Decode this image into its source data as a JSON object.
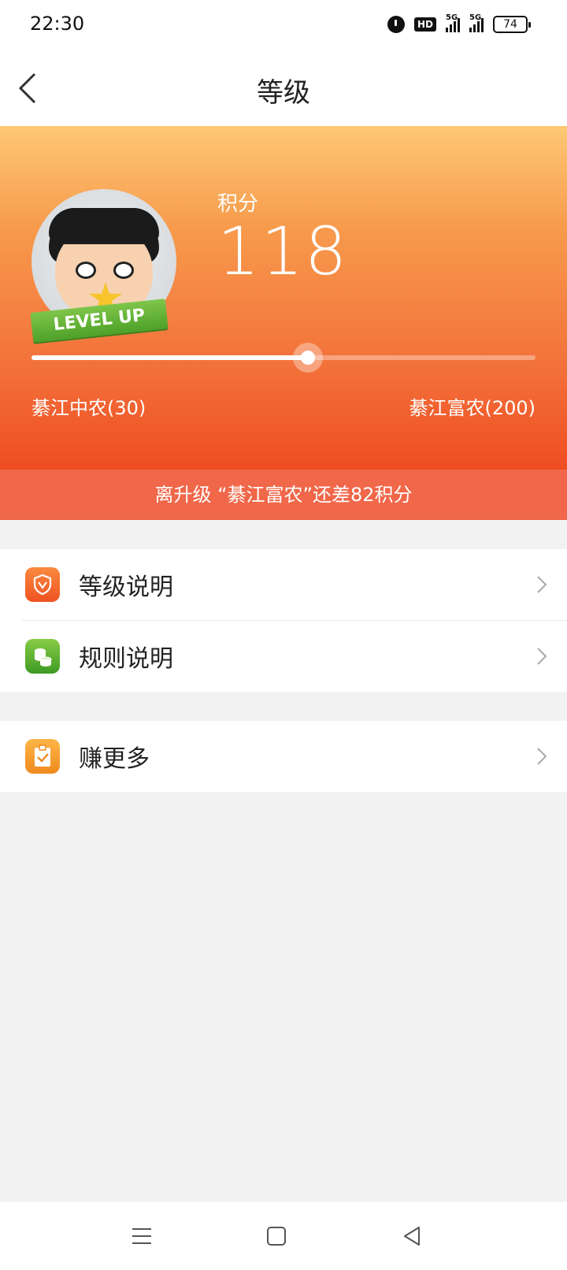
{
  "status": {
    "time": "22:30",
    "hd": "HD",
    "signal1": "5G",
    "signal2": "5G",
    "battery": "74"
  },
  "header": {
    "title": "等级"
  },
  "profile": {
    "badge": "LEVEL UP",
    "points_label": "积分",
    "points_value": "118",
    "progress_fraction": 0.548,
    "current_level": "綦江中农(30)",
    "next_level": "綦江富农(200)"
  },
  "banner": {
    "text": "离升级 “綦江富农”还差82积分"
  },
  "menu": {
    "items": [
      {
        "label": "等级说明",
        "icon": "shield-icon"
      },
      {
        "label": "规则说明",
        "icon": "coins-icon"
      }
    ],
    "earn": {
      "label": "赚更多",
      "icon": "clipboard-check-icon"
    }
  },
  "colors": {
    "hero_top": "#fdc874",
    "hero_bottom": "#ef4d23",
    "banner": "#f06749"
  }
}
